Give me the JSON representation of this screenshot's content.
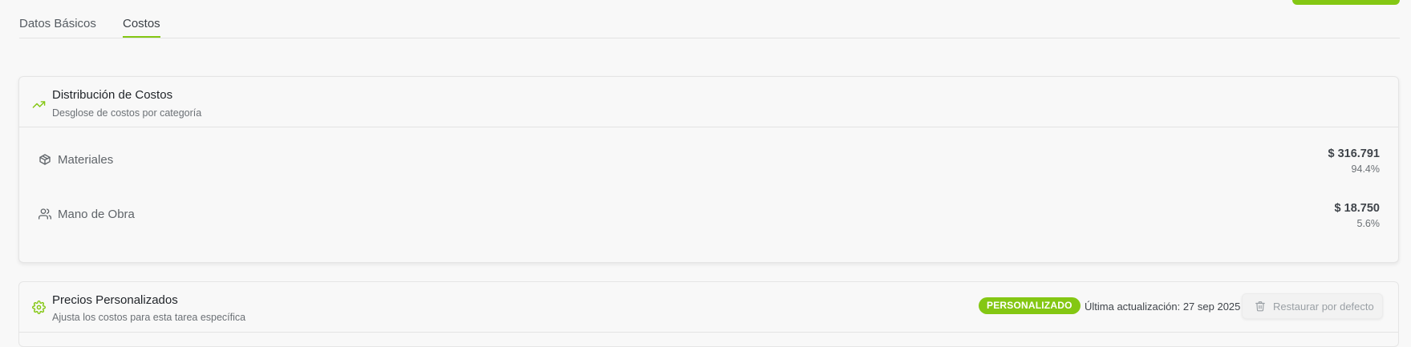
{
  "tabs": [
    {
      "label": "Datos Básicos",
      "active": false
    },
    {
      "label": "Costos",
      "active": true
    }
  ],
  "distribution": {
    "title": "Distribución de Costos",
    "subtitle": "Desglose de costos por categoría",
    "icon": "trending-up-icon",
    "items": [
      {
        "label": "Materiales",
        "value": "$ 316.791",
        "percent": "94.4%",
        "icon": "package-icon"
      },
      {
        "label": "Mano de Obra",
        "value": "$ 18.750",
        "percent": "5.6%",
        "icon": "users-icon"
      }
    ]
  },
  "custom_prices": {
    "title": "Precios Personalizados",
    "subtitle": "Ajusta los costos para esta tarea específica",
    "icon": "settings-gear-icon",
    "badge": "PERSONALIZADO",
    "last_updated": "Última actualización: 27 sep 2025",
    "restore_label": "Restaurar por defecto"
  },
  "colors": {
    "accent": "#84c713",
    "text": "#1f2328",
    "muted": "#6b7075"
  }
}
